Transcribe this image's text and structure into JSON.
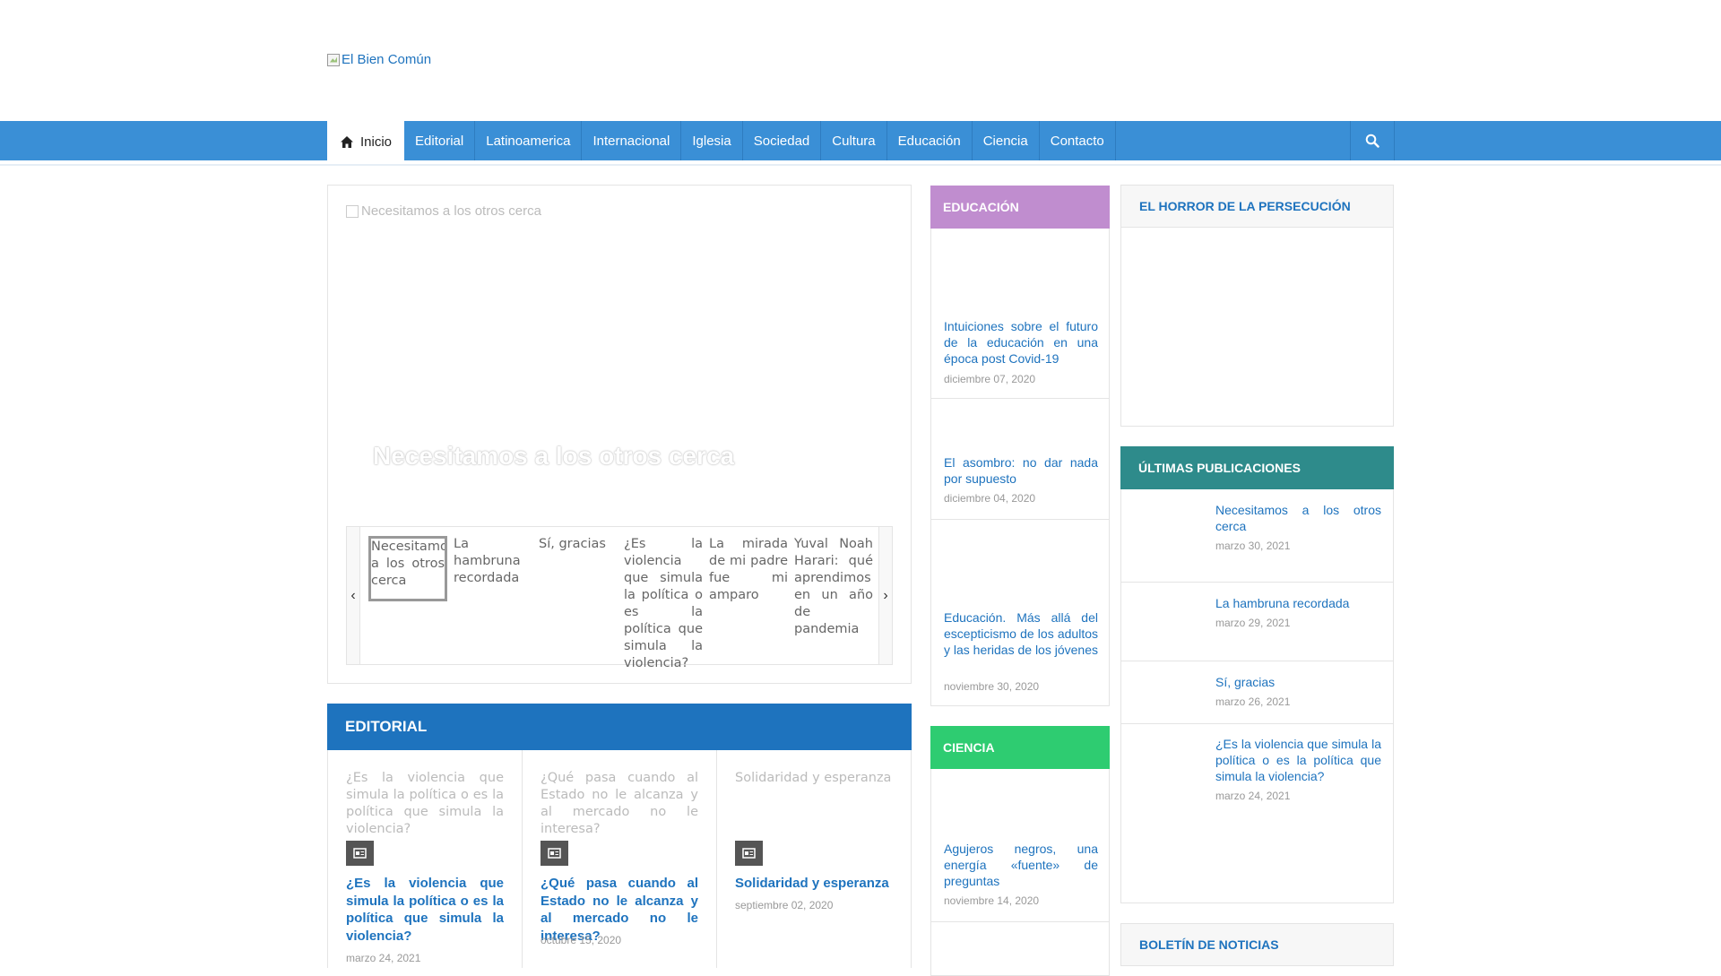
{
  "site": {
    "logo_alt": "El Bien Común"
  },
  "nav": {
    "items": [
      "Inicio",
      "Editorial",
      "Latinoamerica",
      "Internacional",
      "Iglesia",
      "Sociedad",
      "Cultura",
      "Educación",
      "Ciencia",
      "Contacto"
    ]
  },
  "slider": {
    "image_alt": "Necesitamos a los otros cerca",
    "title": "Necesitamos a los otros cerca",
    "thumbs": [
      "Necesitamos a los otros cerca",
      "La hambruna recordada",
      "Sí, gracias",
      "¿Es la violencia que simula la política o es la política que simula la violencia?",
      "La mirada de mi padre fue mi amparo",
      "Yuval Noah Harari: qué aprendimos en un año de pandemia"
    ]
  },
  "editorial": {
    "heading": "EDITORIAL",
    "articles": [
      {
        "alt": "¿Es la violencia que simula la política o es la política que simula la violencia?",
        "title": "¿Es la violencia que simula la política o es la política que simula la violencia?",
        "date": "marzo 24, 2021"
      },
      {
        "alt": "¿Qué pasa cuando al Estado no le alcanza y al mercado no le interesa?",
        "title": "¿Qué pasa cuando al Estado no le alcanza y al mercado no le interesa?",
        "date": "octubre 15, 2020"
      },
      {
        "alt": "Solidaridad y esperanza",
        "title": "Solidaridad y esperanza",
        "date": "septiembre 02, 2020"
      }
    ]
  },
  "educacion": {
    "heading": "EDUCACIÓN",
    "articles": [
      {
        "title": "Intuiciones sobre el futuro de la educación en una época post Covid-19",
        "date": "diciembre 07, 2020"
      },
      {
        "title": "El asombro: no dar nada por supuesto",
        "date": "diciembre 04, 2020"
      },
      {
        "title": "Educación. Más allá del escepticismo de los adultos y las heridas de los jóvenes",
        "date": "noviembre 30, 2020"
      }
    ]
  },
  "ciencia": {
    "heading": "CIENCIA",
    "articles": [
      {
        "title": "Agujeros negros, una energía «fuente» de preguntas",
        "date": "noviembre 14, 2020"
      }
    ]
  },
  "horror": {
    "heading": "EL HORROR DE LA PERSECUCIÓN"
  },
  "ultimas": {
    "heading": "ÚLTIMAS PUBLICACIONES",
    "posts": [
      {
        "title": "Necesitamos a los otros cerca",
        "date": "marzo 30, 2021"
      },
      {
        "title": "La hambruna recordada",
        "date": "marzo 29, 2021"
      },
      {
        "title": "Sí, gracias",
        "date": "marzo 26, 2021"
      },
      {
        "title": "¿Es la violencia que simula la política o es la política que simula la violencia?",
        "date": "marzo 24, 2021"
      }
    ]
  },
  "boletin": {
    "heading": "BOLETÍN DE NOTICIAS"
  },
  "colors": {
    "nav": "#3a8fd6",
    "editorial": "#1e73be",
    "educacion": "#c08dcf",
    "ciencia": "#2ecc71",
    "ultimas": "#2e8b8b"
  }
}
